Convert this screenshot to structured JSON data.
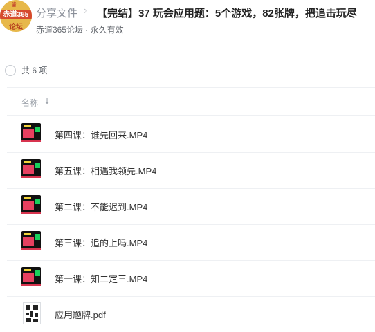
{
  "header": {
    "avatar_crown": "♛",
    "avatar_brand": "赤道365",
    "avatar_forum": "论坛",
    "breadcrumb_root": "分享文件",
    "breadcrumb_sep": "›",
    "share_title": "【完结】37 玩会应用题：5个游戏，82张牌，把追击玩尽",
    "subline": "赤道365论坛 · 永久有效"
  },
  "list": {
    "count_label": "共 6 项",
    "column_name": "名称",
    "sort_icon": "↓",
    "files": [
      {
        "name": "第四课：谁先回来.MP4",
        "type": "video"
      },
      {
        "name": "第五课：相遇我领先.MP4",
        "type": "video"
      },
      {
        "name": "第二课：不能迟到.MP4",
        "type": "video"
      },
      {
        "name": "第三课：追的上吗.MP4",
        "type": "video"
      },
      {
        "name": "第一课：知二定三.MP4",
        "type": "video"
      },
      {
        "name": "应用题牌.pdf",
        "type": "pdf"
      }
    ]
  }
}
